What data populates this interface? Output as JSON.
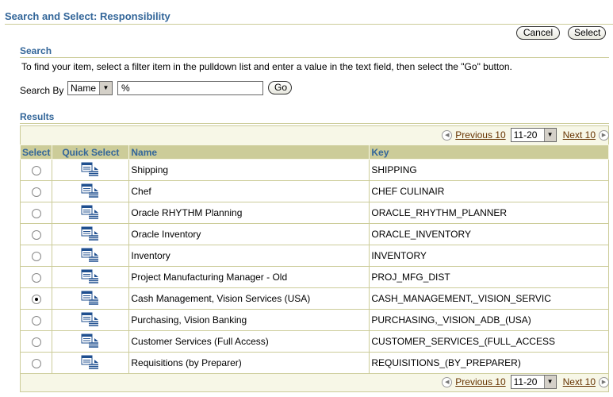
{
  "page": {
    "title": "Search and Select: Responsibility"
  },
  "actions": {
    "cancel_label": "Cancel",
    "select_label": "Select"
  },
  "search": {
    "heading": "Search",
    "instructions": "To find your item, select a filter item in the pulldown list and enter a value in the text field, then select the \"Go\" button.",
    "search_by_label": "Search By",
    "search_by_value": "Name",
    "query_value": "%",
    "go_label": "Go"
  },
  "results": {
    "heading": "Results",
    "nav": {
      "previous_label": "Previous 10",
      "next_label": "Next 10",
      "range_value": "11-20"
    },
    "columns": {
      "select": "Select",
      "quick_select": "Quick Select",
      "name": "Name",
      "key": "Key"
    },
    "rows": [
      {
        "name": "Shipping",
        "key": "SHIPPING",
        "selected": false
      },
      {
        "name": "Chef",
        "key": "CHEF CULINAIR",
        "selected": false
      },
      {
        "name": "Oracle RHYTHM Planning",
        "key": "ORACLE_RHYTHM_PLANNER",
        "selected": false
      },
      {
        "name": "Oracle Inventory",
        "key": "ORACLE_INVENTORY",
        "selected": false
      },
      {
        "name": "Inventory",
        "key": "INVENTORY",
        "selected": false
      },
      {
        "name": "Project Manufacturing Manager - Old",
        "key": "PROJ_MFG_DIST",
        "selected": false
      },
      {
        "name": "Cash Management, Vision Services (USA)",
        "key": "CASH_MANAGEMENT,_VISION_SERVIC",
        "selected": true
      },
      {
        "name": "Purchasing, Vision Banking",
        "key": "PURCHASING,_VISION_ADB_(USA)",
        "selected": false
      },
      {
        "name": "Customer Services (Full Access)",
        "key": "CUSTOMER_SERVICES_(FULL_ACCESS",
        "selected": false
      },
      {
        "name": "Requisitions (by Preparer)",
        "key": "REQUISITIONS_(BY_PREPARER)",
        "selected": false
      }
    ]
  },
  "colors": {
    "header_blue": "#336699",
    "table_header_bg": "#cccc99",
    "link_brown": "#663300"
  }
}
